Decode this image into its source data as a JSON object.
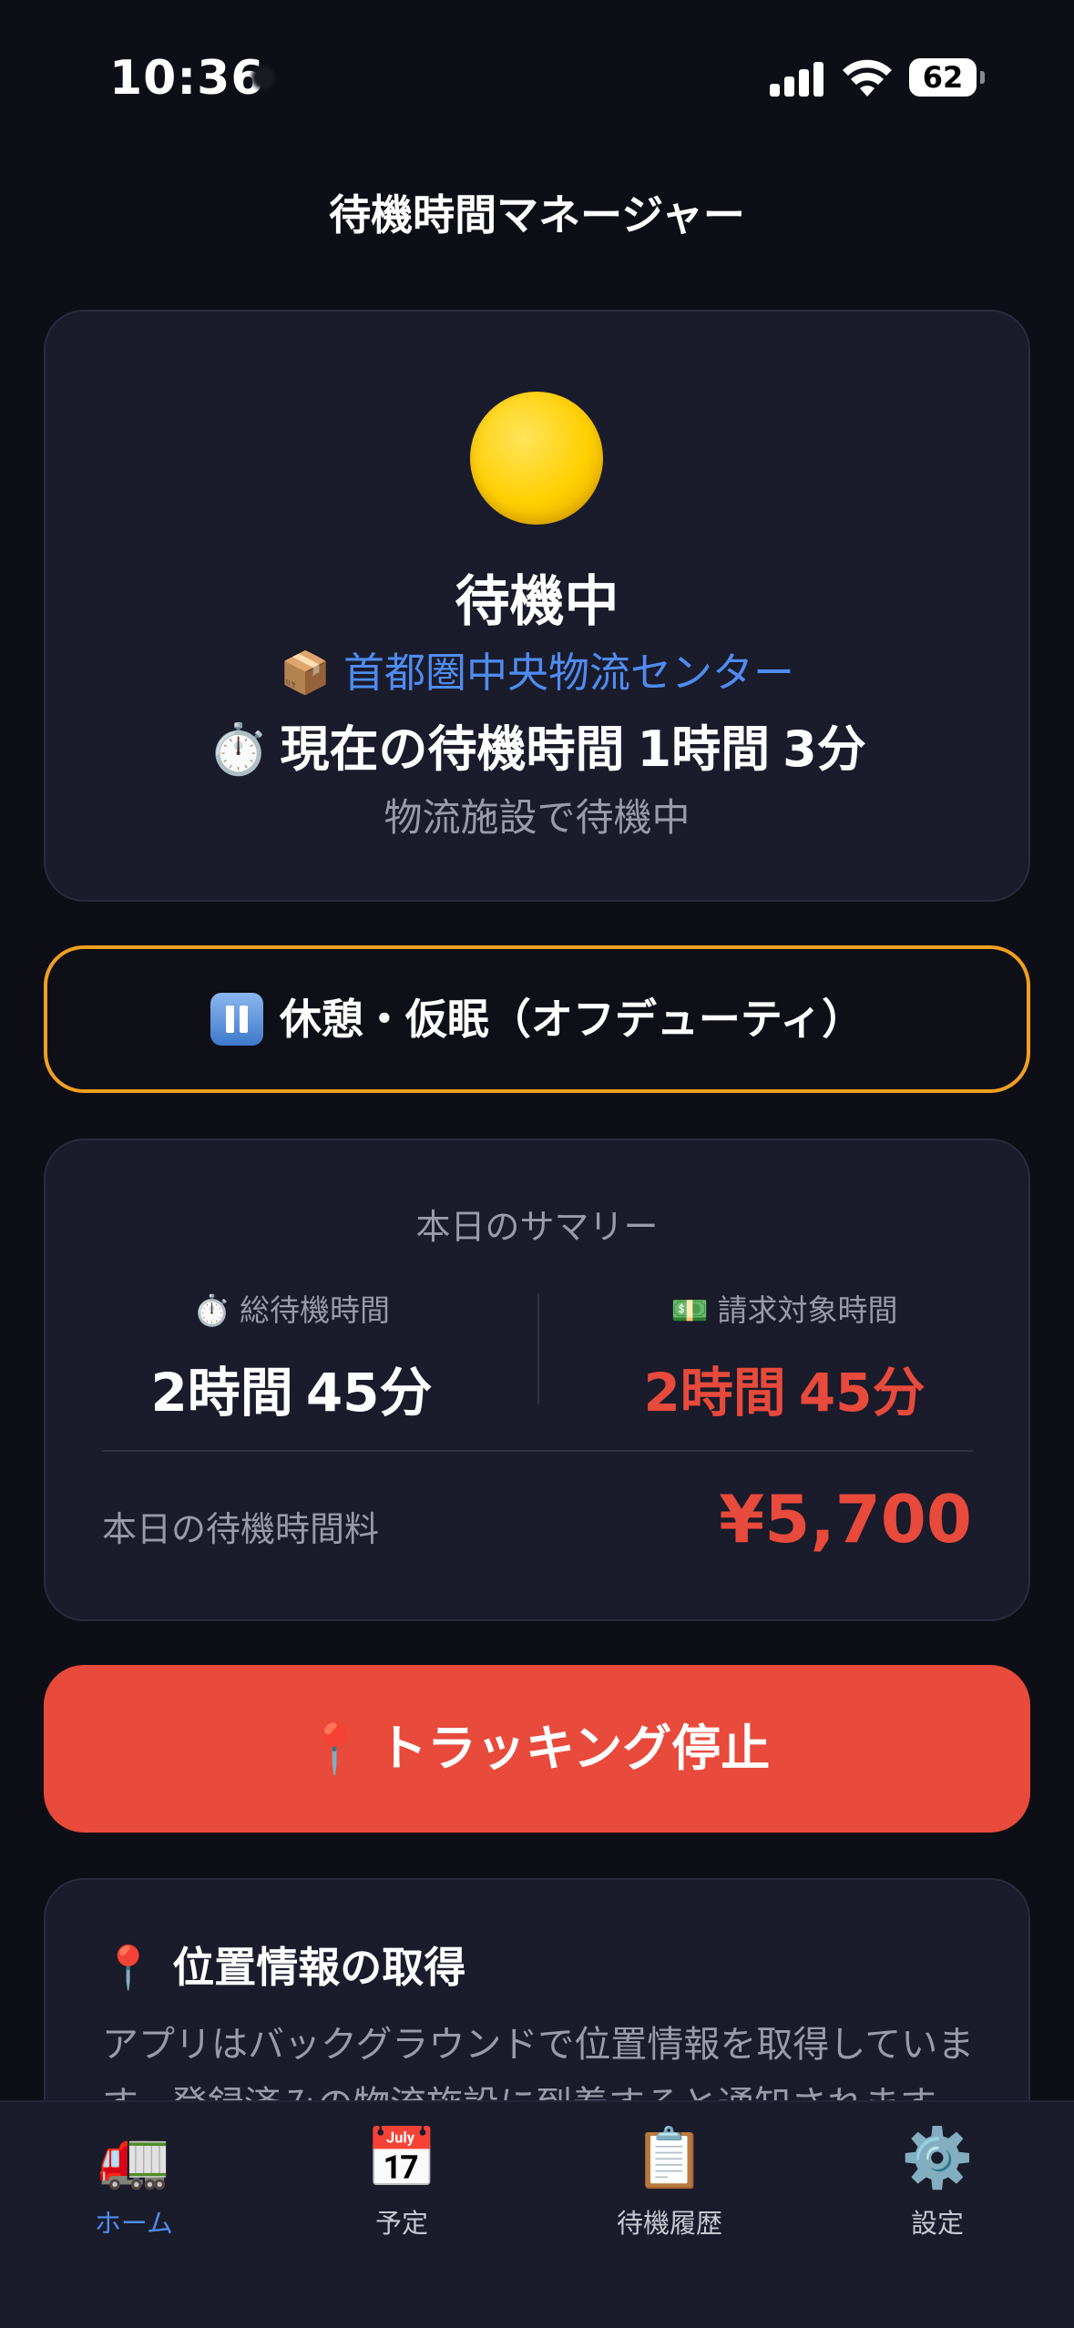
{
  "status_bar": {
    "time": "10:36",
    "battery": "62"
  },
  "nav": {
    "title": "待機時間マネージャー"
  },
  "status_card": {
    "status_label": "待機中",
    "facility_icon": "📦",
    "facility_name": "首都圏中央物流センター",
    "wait_icon": "⏱️",
    "wait_prefix": "現在の待機時間",
    "wait_hours": "1時間",
    "wait_minutes": "3分",
    "subtitle": "物流施設で待機中",
    "indicator_color": "#ffd000"
  },
  "break_button": {
    "label": "休憩・仮眠（オフデューティ）",
    "icon": "pause-icon",
    "border_color": "#f0a020"
  },
  "summary": {
    "title": "本日のサマリー",
    "total_wait": {
      "icon": "⏱️",
      "label": "総待機時間",
      "hours": "2時間",
      "minutes": "45分"
    },
    "billable": {
      "icon": "💵",
      "label": "請求対象時間",
      "hours": "2時間",
      "minutes": "45分"
    },
    "fee_label": "本日の待機時間料",
    "fee_value": "¥5,700",
    "accent_color": "#e84a3c"
  },
  "tracking_button": {
    "icon": "📍",
    "label": "トラッキング停止",
    "color": "#e84a3c"
  },
  "location_card": {
    "icon": "📍",
    "title": "位置情報の取得",
    "body": "アプリはバックグラウンドで位置情報を取得しています。登録済みの物流施設に到着すると通知されます。"
  },
  "tabs": [
    {
      "icon": "🚛",
      "label": "ホーム",
      "active": true
    },
    {
      "icon": "📅",
      "label": "予定",
      "active": false
    },
    {
      "icon": "📋",
      "label": "待機履歴",
      "active": false
    },
    {
      "icon": "⚙️",
      "label": "設定",
      "active": false
    }
  ]
}
